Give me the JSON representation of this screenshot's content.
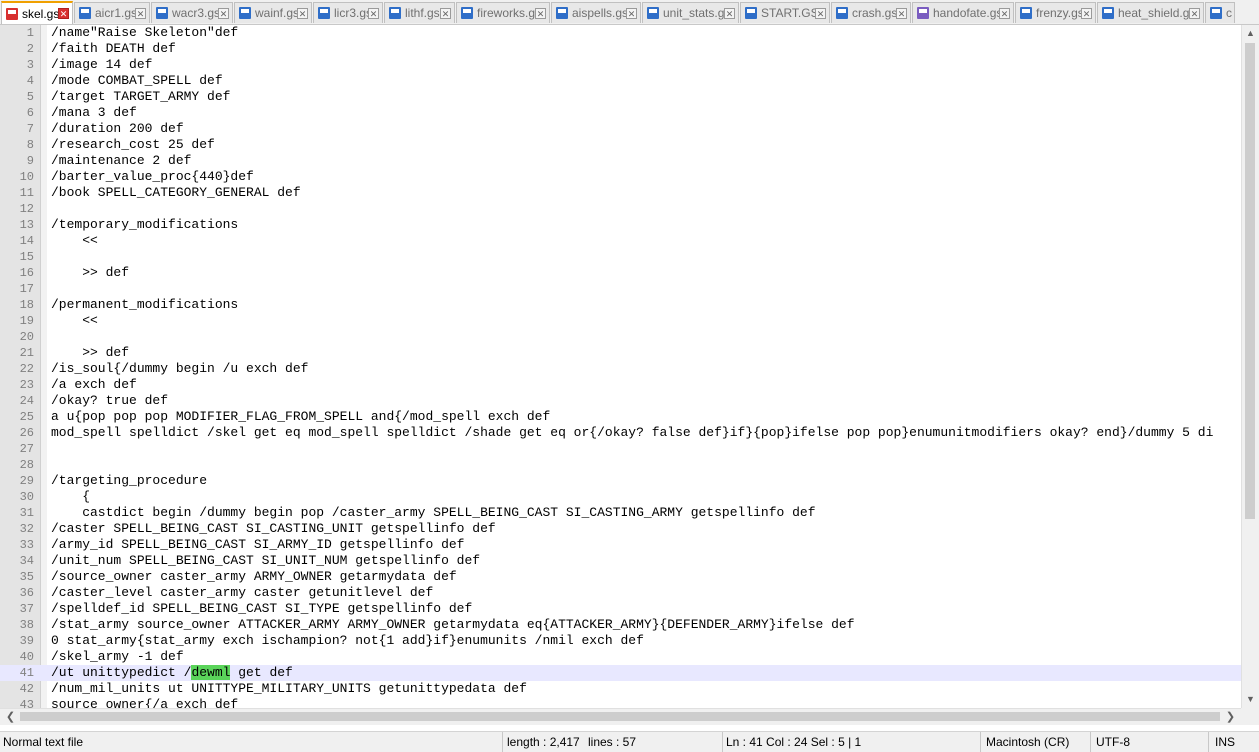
{
  "tabs": [
    {
      "label": "skel.gs",
      "active": true
    },
    {
      "label": "aicr1.gs"
    },
    {
      "label": "wacr3.gs"
    },
    {
      "label": "wainf.gs"
    },
    {
      "label": "licr3.gs"
    },
    {
      "label": "lithf.gs"
    },
    {
      "label": "fireworks.gs"
    },
    {
      "label": "aispells.gs"
    },
    {
      "label": "unit_stats.gs"
    },
    {
      "label": "START.GS"
    },
    {
      "label": "crash.gs"
    },
    {
      "label": "handofate.gs"
    },
    {
      "label": "frenzy.gs"
    },
    {
      "label": "heat_shield.gs"
    },
    {
      "label": "c"
    }
  ],
  "editor": {
    "lines": [
      {
        "n": "1",
        "text": "/name\"Raise Skeleton\"def"
      },
      {
        "n": "2",
        "text": "/faith DEATH def"
      },
      {
        "n": "3",
        "text": "/image 14 def"
      },
      {
        "n": "4",
        "text": "/mode COMBAT_SPELL def"
      },
      {
        "n": "5",
        "text": "/target TARGET_ARMY def"
      },
      {
        "n": "6",
        "text": "/mana 3 def"
      },
      {
        "n": "7",
        "text": "/duration 200 def"
      },
      {
        "n": "8",
        "text": "/research_cost 25 def"
      },
      {
        "n": "9",
        "text": "/maintenance 2 def"
      },
      {
        "n": "10",
        "text": "/barter_value_proc{440}def"
      },
      {
        "n": "11",
        "text": "/book SPELL_CATEGORY_GENERAL def"
      },
      {
        "n": "12",
        "text": ""
      },
      {
        "n": "13",
        "text": "/temporary_modifications"
      },
      {
        "n": "14",
        "text": "    <<"
      },
      {
        "n": "15",
        "text": ""
      },
      {
        "n": "16",
        "text": "    >> def"
      },
      {
        "n": "17",
        "text": ""
      },
      {
        "n": "18",
        "text": "/permanent_modifications"
      },
      {
        "n": "19",
        "text": "    <<"
      },
      {
        "n": "20",
        "text": ""
      },
      {
        "n": "21",
        "text": "    >> def"
      },
      {
        "n": "22",
        "text": "/is_soul{/dummy begin /u exch def"
      },
      {
        "n": "23",
        "text": "/a exch def"
      },
      {
        "n": "24",
        "text": "/okay? true def"
      },
      {
        "n": "25",
        "text": "a u{pop pop pop MODIFIER_FLAG_FROM_SPELL and{/mod_spell exch def"
      },
      {
        "n": "26",
        "text": "mod_spell spelldict /skel get eq mod_spell spelldict /shade get eq or{/okay? false def}if}{pop}ifelse pop pop}enumunitmodifiers okay? end}/dummy 5 di"
      },
      {
        "n": "27",
        "text": ""
      },
      {
        "n": "28",
        "text": ""
      },
      {
        "n": "29",
        "text": "/targeting_procedure"
      },
      {
        "n": "30",
        "text": "    {"
      },
      {
        "n": "31",
        "text": "    castdict begin /dummy begin pop /caster_army SPELL_BEING_CAST SI_CASTING_ARMY getspellinfo def"
      },
      {
        "n": "32",
        "text": "/caster SPELL_BEING_CAST SI_CASTING_UNIT getspellinfo def"
      },
      {
        "n": "33",
        "text": "/army_id SPELL_BEING_CAST SI_ARMY_ID getspellinfo def"
      },
      {
        "n": "34",
        "text": "/unit_num SPELL_BEING_CAST SI_UNIT_NUM getspellinfo def"
      },
      {
        "n": "35",
        "text": "/source_owner caster_army ARMY_OWNER getarmydata def"
      },
      {
        "n": "36",
        "text": "/caster_level caster_army caster getunitlevel def"
      },
      {
        "n": "37",
        "text": "/spelldef_id SPELL_BEING_CAST SI_TYPE getspellinfo def"
      },
      {
        "n": "38",
        "text": "/stat_army source_owner ATTACKER_ARMY ARMY_OWNER getarmydata eq{ATTACKER_ARMY}{DEFENDER_ARMY}ifelse def"
      },
      {
        "n": "39",
        "text": "0 stat_army{stat_army exch ischampion? not{1 add}if}enumunits /nmil exch def"
      },
      {
        "n": "40",
        "text": "/skel_army -1 def"
      },
      {
        "n": "41",
        "pre": "/ut unittypedict /",
        "sel": "dewml",
        "post": " get def",
        "current": true
      },
      {
        "n": "42",
        "text": "/num_mil_units ut UNITTYPE_MILITARY_UNITS getunittypedata def"
      },
      {
        "n": "43",
        "text": "source_owner{/a exch def"
      }
    ]
  },
  "status": {
    "filetype": "Normal text file",
    "length": "length : 2,417",
    "lines": "lines : 57",
    "position": "Ln : 41    Col : 24    Sel : 5 | 1",
    "eol": "Macintosh (CR)",
    "encoding": "UTF-8",
    "mode": "INS"
  },
  "colors": {
    "selection": "#5ad45a",
    "current_line": "#e8e8ff",
    "active_tab_accent": "#f0a000"
  }
}
